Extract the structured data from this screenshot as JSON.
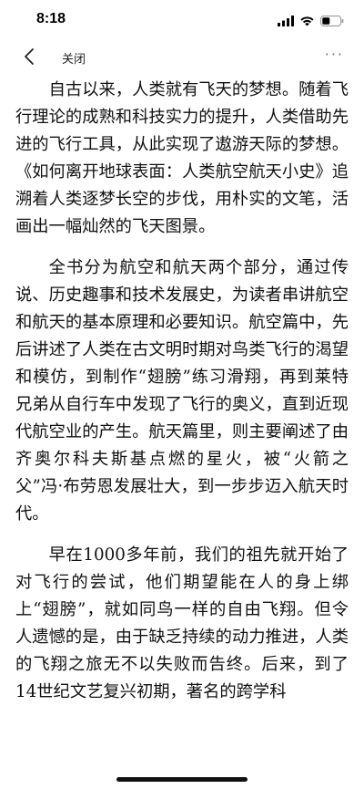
{
  "status_bar": {
    "time": "8:18"
  },
  "nav": {
    "back_icon": "chevron-left-icon",
    "close_label": "关闭",
    "more_label": "···"
  },
  "article": {
    "paragraphs": [
      "自古以来，人类就有飞天的梦想。随着飞行理论的成熟和科技实力的提升，人类借助先进的飞行工具，从此实现了遨游天际的梦想。《如何离开地球表面：人类航空航天小史》追溯着人类逐梦长空的步伐，用朴实的文笔，活画出一幅灿然的飞天图景。",
      "全书分为航空和航天两个部分，通过传说、历史趣事和技术发展史，为读者串讲航空和航天的基本原理和必要知识。航空篇中，先后讲述了人类在古文明时期对鸟类飞行的渴望和模仿，到制作“翅膀”练习滑翔，再到莱特兄弟从自行车中发现了飞行的奥义，直到近现代航空业的产生。航天篇里，则主要阐述了由齐奥尔科夫斯基点燃的星火，被“火箭之父”冯·布劳恩发展壮大，到一步步迈入航天时代。",
      "早在1000多年前，我们的祖先就开始了对飞行的尝试，他们期望能在人的身上绑上“翅膀”，就如同鸟一样的自由飞翔。但令人遗憾的是，由于缺乏持续的动力推进，人类的飞翔之旅无不以失败而告终。后来，到了14世纪文艺复兴初期，著名的跨学科"
    ]
  }
}
